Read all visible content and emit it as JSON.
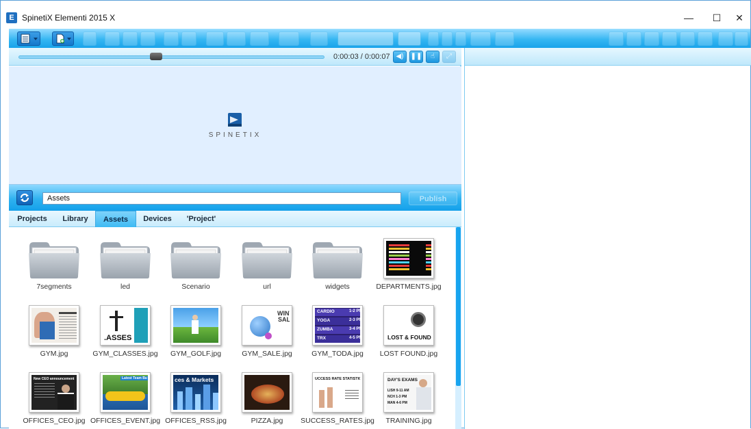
{
  "window": {
    "title": "SpinetiX Elementi 2015 X",
    "app_icon": "E",
    "minimize": "—",
    "maximize": "☐",
    "close": "✕"
  },
  "player": {
    "time": "0:00:03 / 0:00:07",
    "progress": 0.45
  },
  "preview": {
    "logo_text": "SPINETIX"
  },
  "assets": {
    "path": "Assets",
    "publish_label": "Publish",
    "tabs": [
      {
        "label": "Projects"
      },
      {
        "label": "Library"
      },
      {
        "label": "Assets",
        "active": true
      },
      {
        "label": "Devices"
      },
      {
        "label": "'Project'"
      }
    ],
    "items": [
      {
        "name": "7segments",
        "kind": "folder"
      },
      {
        "name": "led",
        "kind": "folder"
      },
      {
        "name": "Scenario",
        "kind": "folder"
      },
      {
        "name": "url",
        "kind": "folder"
      },
      {
        "name": "widgets",
        "kind": "folder"
      },
      {
        "name": "DEPARTMENTS.jpg",
        "kind": "image"
      },
      {
        "name": "GYM.jpg",
        "kind": "image"
      },
      {
        "name": "GYM_CLASSES.jpg",
        "kind": "image",
        "overlay": ".ASSES"
      },
      {
        "name": "GYM_GOLF.jpg",
        "kind": "image"
      },
      {
        "name": "GYM_SALE.jpg",
        "kind": "image",
        "overlay": "WINT SAL"
      },
      {
        "name": "GYM_TODA.jpg",
        "kind": "image",
        "rows": [
          "CARDIO",
          "YOGA",
          "ZUMBA",
          "TRX"
        ],
        "times": [
          "1-2 PM",
          "2-3 PM",
          "3-4 PM",
          "4-5 PM"
        ]
      },
      {
        "name": "LOST FOUND.jpg",
        "kind": "image",
        "overlay": "LOST & FOUND"
      },
      {
        "name": "OFFICES_CEO.jpg",
        "kind": "image",
        "overlay": "New CEO announcement"
      },
      {
        "name": "OFFICES_EVENT.jpg",
        "kind": "image",
        "overlay": "Latest Team Bu"
      },
      {
        "name": "OFFICES_RSS.jpg",
        "kind": "image",
        "overlay": "ces & Markets"
      },
      {
        "name": "PIZZA.jpg",
        "kind": "image"
      },
      {
        "name": "SUCCESS_RATES.jpg",
        "kind": "image",
        "overlay": "UCCESS RATE STATISTIC!"
      },
      {
        "name": "TRAINING.jpg",
        "kind": "image",
        "overlay": "DAY'S EXAMS",
        "lines": [
          "LISH 9-11 AM",
          "NCH 1-3 PM",
          "MAN 4-6 PM"
        ]
      }
    ]
  }
}
